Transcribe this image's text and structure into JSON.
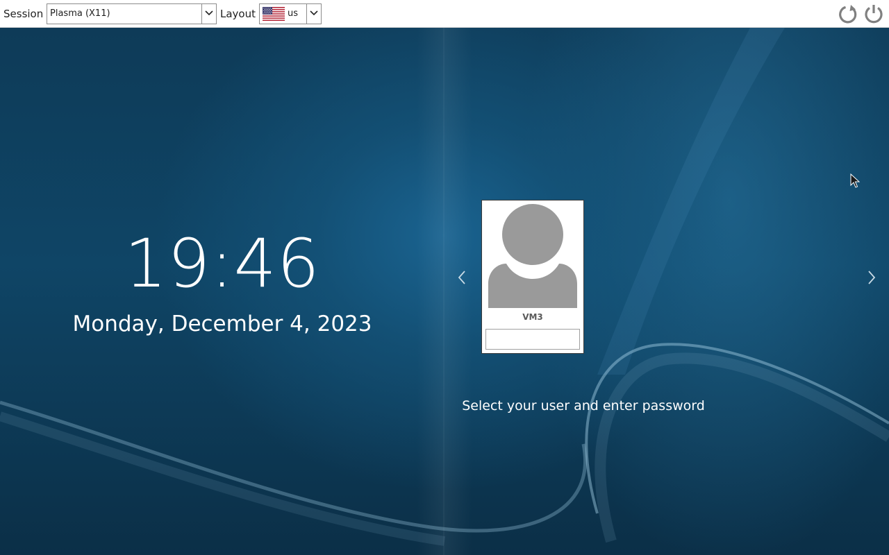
{
  "topbar": {
    "session_label": "Session",
    "session_value": "Plasma (X11)",
    "layout_label": "Layout",
    "layout_value": "us",
    "layout_flag_icon": "us-flag-icon",
    "reboot_icon": "reboot-icon",
    "shutdown_icon": "power-icon"
  },
  "clock": {
    "time": "19:46",
    "date": "Monday, December 4, 2023"
  },
  "login": {
    "user_name": "VM3",
    "password_value": "",
    "hint": "Select your user and enter password",
    "prev_icon": "chevron-left-icon",
    "next_icon": "chevron-right-icon",
    "avatar_icon": "default-user-avatar-icon"
  },
  "colors": {
    "background_dark": "#0b2a3f",
    "background_accent": "#1a6390",
    "topbar_bg": "#ffffff",
    "icon_gray": "#808080"
  }
}
